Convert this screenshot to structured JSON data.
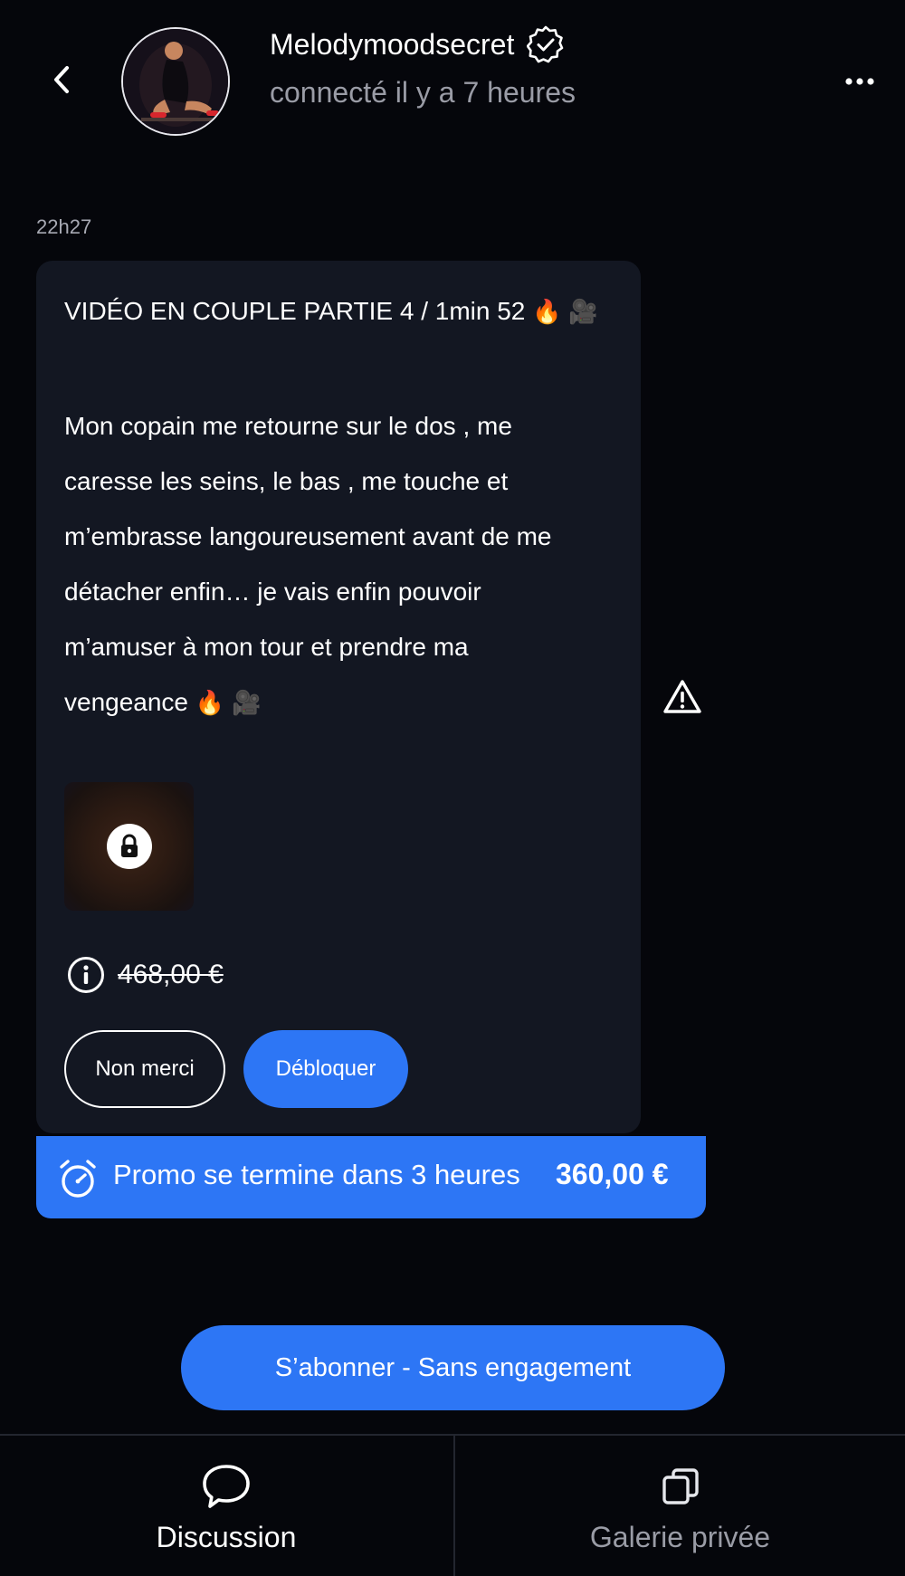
{
  "header": {
    "username": "Melodymoodsecret",
    "status": "connecté il y a 7 heures",
    "back_icon": "chevron-left-icon",
    "verified_icon": "verified-badge-icon",
    "more_icon": "more-horizontal-icon"
  },
  "message": {
    "timestamp": "22h27",
    "title": "VIDÉO EN COUPLE PARTIE 4 / 1min 52",
    "body_lines": [
      "Mon copain me retourne sur le dos , me",
      "caresse les seins, le bas , me touche et",
      "m’embrasse langoureusement avant de me",
      "détacher enfin… je vais enfin pouvoir",
      "m’amuser à mon tour et prendre ma",
      "vengeance"
    ],
    "emojis": {
      "fire": "🔥",
      "camera": "🎥"
    },
    "old_price": "468,00 €",
    "decline_label": "Non merci",
    "unlock_label": "Débloquer"
  },
  "promo": {
    "text": "Promo se termine dans 3 heures",
    "price": "360,00 €"
  },
  "subscribe": {
    "label": "S’abonner - Sans engagement"
  },
  "bottom_nav": {
    "tabs": [
      {
        "label": "Discussion",
        "icon": "chat-bubble-icon",
        "active": true
      },
      {
        "label": "Galerie privée",
        "icon": "gallery-copy-icon",
        "active": false
      }
    ]
  },
  "colors": {
    "background": "#05060b",
    "card": "#131722",
    "accent": "#2d76f5",
    "muted_text": "#9a9ca6"
  }
}
